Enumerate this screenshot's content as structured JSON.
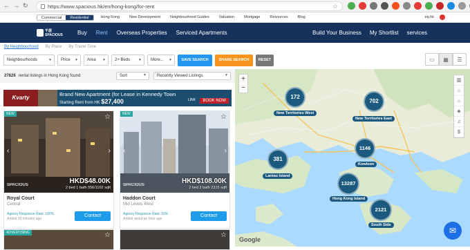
{
  "browser": {
    "url": "https://www.spacious.hk/en/hong-kong/for-rent"
  },
  "topbar": {
    "segments": [
      "Commercial",
      "Residential"
    ],
    "links": [
      "Hong Kong",
      "New Development",
      "Neighbourhood Guides",
      "Valuation",
      "Mortgage",
      "Resources",
      "Blog"
    ],
    "lang": "eq.hk"
  },
  "nav": {
    "logo": "千居 SPACIOUS",
    "items": [
      "Buy",
      "Rent",
      "Overseas Properties",
      "Serviced Apartments"
    ],
    "right": [
      "Build Your Business",
      "My Shortlist",
      "services"
    ]
  },
  "filters": {
    "tabs": [
      "By Neighbourhood",
      "By Place",
      "By Travel Time"
    ],
    "selects": [
      "Neighbourhoods",
      "Price",
      "Area",
      "2+ Beds",
      "More..."
    ],
    "save": "SAVE SEARCH",
    "share": "SHARE SEARCH",
    "reset": "RESET"
  },
  "list": {
    "count": "27826",
    "count_text": "rental listings in Hong Kong found",
    "sort": "Sort",
    "sort2": "Recently Viewed Listings"
  },
  "banner": {
    "brand": "Kvarty",
    "title": "Brand New Apartment (for Lease in Kennedy Town",
    "from": "Starting Rent from HK",
    "price": "$27,400",
    "book": "BOOK NOW",
    "brand2": "LINK"
  },
  "cards": [
    {
      "tag": "NEW",
      "price": "HKD$48.00K",
      "spec": "2 bed 1 bath 556/1102 sqft",
      "name": "Royal Court",
      "area": "Central",
      "rate": "Agency Response Rate: 100%",
      "added": "Added 20 minutes ago",
      "contact": "Contact",
      "wm": "SPACIOUS"
    },
    {
      "tag": "NEW",
      "price": "HKD$108.00K",
      "spec": "2 bed 2 bath 2315 sqft",
      "name": "Haddon Court",
      "area": "Mid Levels West",
      "rate": "Agency Response Rate: 93%",
      "added": "Added about an hour ago",
      "contact": "Contact",
      "wm": "SPACIOUS"
    }
  ],
  "card_extra": {
    "tag": "ADVERTISING"
  },
  "map": {
    "clusters": [
      {
        "count": "172",
        "label": "New Territories West"
      },
      {
        "count": "702",
        "label": "New Territories East"
      },
      {
        "count": "1146",
        "label": "Kowloon"
      },
      {
        "count": "381",
        "label": "Lantau Island"
      },
      {
        "count": "13287",
        "label": "Hong Kong Island"
      },
      {
        "count": "2121",
        "label": "South Side"
      }
    ],
    "google": "Google"
  }
}
